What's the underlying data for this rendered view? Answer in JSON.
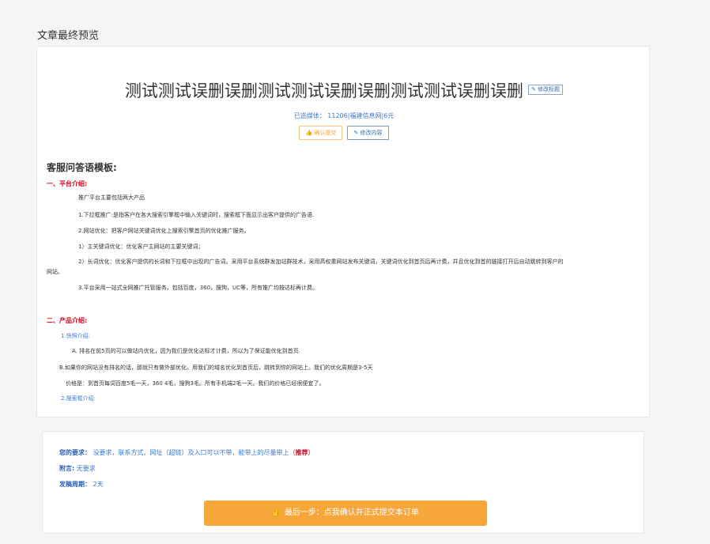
{
  "page": {
    "section_title": "文章最终预览"
  },
  "article": {
    "title": "测试测试误删误删测试测试误删误删测试测试误删误删",
    "edit_title_label": "修改标题",
    "media_prefix": "已选媒体：",
    "media_value": "11206|福建信息网|6元",
    "confirm_label": "确认提交",
    "edit_content_label": "修改内容"
  },
  "template": {
    "heading": "客服问答语模板:",
    "section1": {
      "title": "一、平台介绍:",
      "lines": [
        "推广平台主要包括两大产品",
        "1.下拉框推广:是指客户在各大搜索引擎框中输入关键词时，搜索框下面显示出客户提供的广告语.",
        "2.网站优化：把客户网站关键词优化上搜索引擎首页的优化推广服务。",
        "1）主关键词优化：优化客户主网站的主要关键词；",
        "2）长词优化：优化客户提供的长词和下拉框中出现的广告词。采用平台系统群发加站群技术，采用高权重网站发布关键词，关键词优化到首页后再计费，并且优化到首的链接打开后自动跳转到客户的",
        "网站。",
        "3.平台采用一站式全网推广托管服务，包括百度，360，搜狗，UC等，所有推广均按达标再计费。"
      ]
    },
    "section2": {
      "title": "二、产品介绍:",
      "sub1": "1.快照介绍:",
      "lines": [
        "A. 排名在前5页的可以做站内优化，因为我们是优化达标才计费，所以为了保证能优化到首页.",
        "B.如果你的网站没有排名的话，那就只有做外部优化，用我们的域名优化到首页后，跳转到你的网站上。我们的优化周期是3-5天",
        "价格是：到首页每词百度5毛一天，360 4毛，搜狗3毛。所有手机端2毛一天。我们的价格已经很便宜了。"
      ],
      "sub2": "2.搜索框介绍:"
    }
  },
  "requirements": {
    "req_label": "您的要求：",
    "req_value": "没要求，联系方式、网址（超链）及入口可以不带，能带上的尽量带上",
    "req_rec_open": "（",
    "req_rec": "推荐",
    "req_rec_close": "）",
    "note_label": "附言:",
    "note_value": "无要求",
    "cycle_label": "发稿周期：",
    "cycle_value": "2天",
    "submit_label": "最后一步：点我确认并正式提交本订单"
  }
}
